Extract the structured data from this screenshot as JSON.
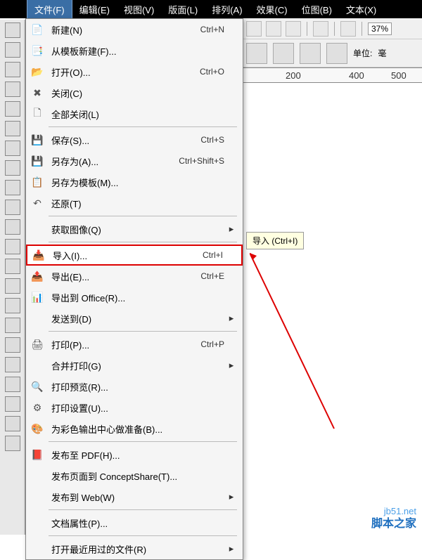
{
  "menubar": {
    "items": [
      "文件(F)",
      "编辑(E)",
      "视图(V)",
      "版面(L)",
      "排列(A)",
      "效果(C)",
      "位图(B)",
      "文本(X)"
    ]
  },
  "zoom": "37%",
  "unit_label": "单位:",
  "unit_value": "毫",
  "ruler": {
    "t1": "200",
    "t2": "400",
    "t3": "500"
  },
  "tooltip": "导入 (Ctrl+I)",
  "menu": [
    {
      "ico": "📄",
      "txt": "新建(N)",
      "sc": "Ctrl+N"
    },
    {
      "ico": "📑",
      "txt": "从模板新建(F)..."
    },
    {
      "ico": "📂",
      "txt": "打开(O)...",
      "sc": "Ctrl+O"
    },
    {
      "ico": "✖",
      "txt": "关闭(C)"
    },
    {
      "ico": "🗋",
      "txt": "全部关闭(L)"
    },
    {
      "sep": true
    },
    {
      "ico": "💾",
      "txt": "保存(S)...",
      "sc": "Ctrl+S"
    },
    {
      "ico": "💾",
      "txt": "另存为(A)...",
      "sc": "Ctrl+Shift+S"
    },
    {
      "ico": "📋",
      "txt": "另存为模板(M)..."
    },
    {
      "ico": "↶",
      "txt": "还原(T)"
    },
    {
      "sep": true
    },
    {
      "txt": "获取图像(Q)",
      "sub": true
    },
    {
      "sep": true
    },
    {
      "ico": "📥",
      "txt": "导入(I)...",
      "sc": "Ctrl+I",
      "hl": true
    },
    {
      "ico": "📤",
      "txt": "导出(E)...",
      "sc": "Ctrl+E"
    },
    {
      "ico": "📊",
      "txt": "导出到 Office(R)..."
    },
    {
      "txt": "发送到(D)",
      "sub": true
    },
    {
      "sep": true
    },
    {
      "ico": "🖨",
      "txt": "打印(P)...",
      "sc": "Ctrl+P"
    },
    {
      "txt": "合并打印(G)",
      "sub": true
    },
    {
      "ico": "🔍",
      "txt": "打印预览(R)..."
    },
    {
      "ico": "⚙",
      "txt": "打印设置(U)..."
    },
    {
      "ico": "🎨",
      "txt": "为彩色输出中心做准备(B)..."
    },
    {
      "sep": true
    },
    {
      "ico": "📕",
      "txt": "发布至 PDF(H)..."
    },
    {
      "txt": "发布页面到 ConceptShare(T)..."
    },
    {
      "txt": "发布到 Web(W)",
      "sub": true
    },
    {
      "sep": true
    },
    {
      "txt": "文档属性(P)..."
    },
    {
      "sep": true
    },
    {
      "txt": "打开最近用过的文件(R)",
      "sub": true
    }
  ],
  "watermark": "脚本之家",
  "watermark2": "jb51.net"
}
